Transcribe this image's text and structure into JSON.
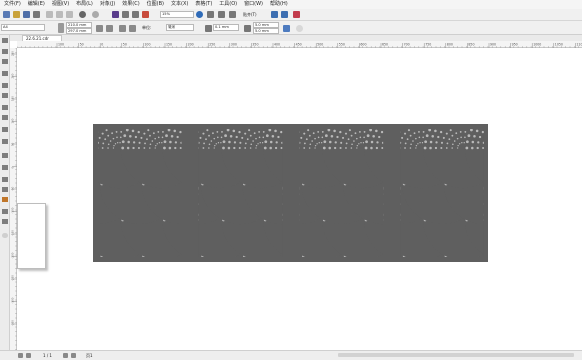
{
  "menu": [
    "文件(F)",
    "编辑(E)",
    "视图(V)",
    "布局(L)",
    "对象(J)",
    "效果(C)",
    "位图(B)",
    "文本(X)",
    "表格(T)",
    "工具(O)",
    "窗口(W)",
    "帮助(H)"
  ],
  "toolbar": {
    "zoom_value": "15%",
    "snap_label": "贴齐(T)"
  },
  "propbar": {
    "page_size": "A4",
    "width": "210.0 mm",
    "height": "297.0 mm",
    "units_label": "单位:",
    "units_value": "毫米",
    "nudge": "0.1 mm",
    "dup_x": "5.0 mm",
    "dup_y": "5.0 mm"
  },
  "document": {
    "tab_name": "22.6.21.cdr"
  },
  "ruler": {
    "top_labels": [
      "100",
      "50",
      "0",
      "50",
      "100",
      "150",
      "200",
      "250",
      "300",
      "350",
      "400",
      "450",
      "500",
      "550",
      "600",
      "650",
      "700",
      "750",
      "800",
      "850",
      "900",
      "950",
      "1000",
      "1050",
      "1100",
      "1150"
    ],
    "left_labels": [
      "250",
      "200",
      "150",
      "100",
      "50",
      "0",
      "-50",
      "-100",
      "-150",
      "-200",
      "-250",
      "-300",
      "-350",
      "-400"
    ]
  },
  "statusbar": {
    "page_counter": "1 / 1",
    "page_tab": "页1"
  },
  "artwork": {
    "panel_count": 4,
    "panel_color": "#5f5f5f",
    "fill_color": "#b9b9b9"
  }
}
